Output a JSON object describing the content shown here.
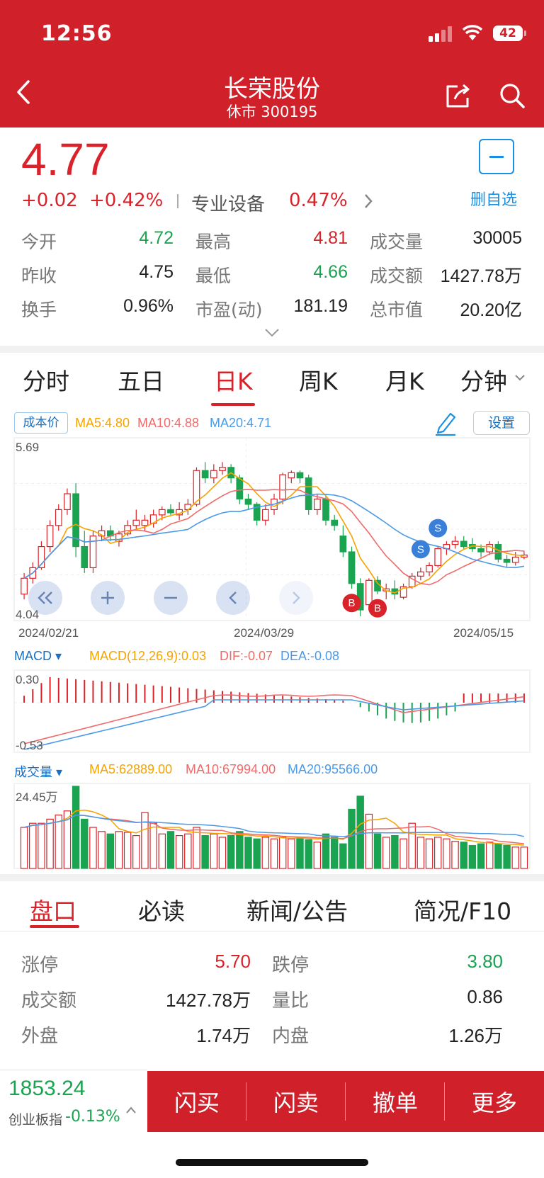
{
  "status": {
    "time": "12:56",
    "battery": "42"
  },
  "header": {
    "title": "长荣股份",
    "subtitle": "休市 300195"
  },
  "quote": {
    "price": "4.77",
    "change": "+0.02",
    "change_pct": "+0.42%",
    "sector": "专业设备",
    "sector_pct": "0.47%",
    "fav_label": "删自选",
    "grid": [
      [
        {
          "label": "今开",
          "value": "4.72",
          "color": "#1aa350"
        },
        {
          "label": "最高",
          "value": "4.81",
          "color": "#d8232a"
        },
        {
          "label": "成交量",
          "value": "30005",
          "color": "#222"
        }
      ],
      [
        {
          "label": "昨收",
          "value": "4.75",
          "color": "#222"
        },
        {
          "label": "最低",
          "value": "4.66",
          "color": "#1aa350"
        },
        {
          "label": "成交额",
          "value": "1427.78万",
          "color": "#222"
        }
      ],
      [
        {
          "label": "换手",
          "value": "0.96%",
          "color": "#222"
        },
        {
          "label": "市盈(动)",
          "value": "181.19",
          "color": "#222"
        },
        {
          "label": "总市值",
          "value": "20.20亿",
          "color": "#222"
        }
      ]
    ]
  },
  "tabs": [
    "分时",
    "五日",
    "日K",
    "周K",
    "月K",
    "分钟"
  ],
  "active_tab": "日K",
  "chart_toolbar": {
    "cost_label": "成本价",
    "ma5": "MA5:4.80",
    "ma10": "MA10:4.88",
    "ma20": "MA20:4.71",
    "settings": "设置"
  },
  "colors": {
    "up": "#d8232a",
    "down": "#1aa350",
    "ma5": "#f5a300",
    "ma10": "#f06a6a",
    "ma20": "#4a9ae8",
    "brand": "#d0202a",
    "link": "#1a8fe3"
  },
  "kline": {
    "ymax": "5.69",
    "ymin": "4.04",
    "dates": [
      "2024/02/21",
      "2024/03/29",
      "2024/05/15"
    ],
    "markers": [
      "S",
      "S",
      "B",
      "B"
    ]
  },
  "macd": {
    "label": "MACD",
    "params": "MACD(12,26,9):0.03",
    "dif": "DIF:-0.07",
    "dea": "DEA:-0.08",
    "ymax": "0.30",
    "ymin": "-0.53"
  },
  "volume": {
    "label": "成交量",
    "ma5": "MA5:62889.00",
    "ma10": "MA10:67994.00",
    "ma20": "MA20:95566.00",
    "ymax": "24.45万"
  },
  "chart_data": {
    "type": "candlestick",
    "x_range": [
      "2024/02/21",
      "2024/05/15"
    ],
    "ylim": [
      4.04,
      5.69
    ],
    "series_candles": [
      {
        "o": 4.25,
        "h": 4.45,
        "l": 4.2,
        "c": 4.4
      },
      {
        "o": 4.4,
        "h": 4.55,
        "l": 4.35,
        "c": 4.5
      },
      {
        "o": 4.5,
        "h": 4.75,
        "l": 4.48,
        "c": 4.7
      },
      {
        "o": 4.7,
        "h": 4.95,
        "l": 4.65,
        "c": 4.9
      },
      {
        "o": 4.9,
        "h": 5.1,
        "l": 4.85,
        "c": 5.05
      },
      {
        "o": 5.05,
        "h": 5.25,
        "l": 5.0,
        "c": 5.2
      },
      {
        "o": 5.2,
        "h": 5.3,
        "l": 4.6,
        "c": 4.7
      },
      {
        "o": 4.7,
        "h": 4.85,
        "l": 4.45,
        "c": 4.5
      },
      {
        "o": 4.5,
        "h": 4.85,
        "l": 4.45,
        "c": 4.8
      },
      {
        "o": 4.8,
        "h": 4.9,
        "l": 4.75,
        "c": 4.85
      },
      {
        "o": 4.85,
        "h": 4.9,
        "l": 4.75,
        "c": 4.8
      },
      {
        "o": 4.75,
        "h": 4.85,
        "l": 4.7,
        "c": 4.82
      },
      {
        "o": 4.82,
        "h": 4.95,
        "l": 4.8,
        "c": 4.9
      },
      {
        "o": 4.9,
        "h": 5.05,
        "l": 4.85,
        "c": 4.95
      },
      {
        "o": 4.9,
        "h": 5.0,
        "l": 4.85,
        "c": 4.95
      },
      {
        "o": 4.92,
        "h": 5.05,
        "l": 4.88,
        "c": 5.0
      },
      {
        "o": 5.0,
        "h": 5.08,
        "l": 4.95,
        "c": 5.05
      },
      {
        "o": 5.05,
        "h": 5.1,
        "l": 5.0,
        "c": 5.02
      },
      {
        "o": 5.0,
        "h": 5.12,
        "l": 4.95,
        "c": 5.05
      },
      {
        "o": 5.05,
        "h": 5.15,
        "l": 5.0,
        "c": 5.1
      },
      {
        "o": 5.1,
        "h": 5.45,
        "l": 5.08,
        "c": 5.42
      },
      {
        "o": 5.42,
        "h": 5.5,
        "l": 5.3,
        "c": 5.35
      },
      {
        "o": 5.35,
        "h": 5.48,
        "l": 5.3,
        "c": 5.42
      },
      {
        "o": 5.42,
        "h": 5.5,
        "l": 5.38,
        "c": 5.45
      },
      {
        "o": 5.45,
        "h": 5.48,
        "l": 5.3,
        "c": 5.35
      },
      {
        "o": 5.35,
        "h": 5.38,
        "l": 5.1,
        "c": 5.15
      },
      {
        "o": 5.15,
        "h": 5.2,
        "l": 5.05,
        "c": 5.1
      },
      {
        "o": 5.1,
        "h": 5.12,
        "l": 4.9,
        "c": 4.95
      },
      {
        "o": 4.95,
        "h": 5.1,
        "l": 4.9,
        "c": 5.05
      },
      {
        "o": 5.05,
        "h": 5.2,
        "l": 5.0,
        "c": 5.15
      },
      {
        "o": 5.15,
        "h": 5.4,
        "l": 5.1,
        "c": 5.38
      },
      {
        "o": 5.35,
        "h": 5.42,
        "l": 5.3,
        "c": 5.4
      },
      {
        "o": 5.4,
        "h": 5.42,
        "l": 5.3,
        "c": 5.35
      },
      {
        "o": 5.35,
        "h": 5.38,
        "l": 5.0,
        "c": 5.05
      },
      {
        "o": 5.05,
        "h": 5.2,
        "l": 5.0,
        "c": 5.15
      },
      {
        "o": 5.15,
        "h": 5.2,
        "l": 4.9,
        "c": 4.95
      },
      {
        "o": 4.95,
        "h": 5.0,
        "l": 4.85,
        "c": 4.9
      },
      {
        "o": 4.8,
        "h": 4.9,
        "l": 4.6,
        "c": 4.65
      },
      {
        "o": 4.65,
        "h": 4.7,
        "l": 4.3,
        "c": 4.35
      },
      {
        "o": 4.35,
        "h": 4.4,
        "l": 4.04,
        "c": 4.1
      },
      {
        "o": 4.15,
        "h": 4.4,
        "l": 4.1,
        "c": 4.38
      },
      {
        "o": 4.38,
        "h": 4.42,
        "l": 4.25,
        "c": 4.28
      },
      {
        "o": 4.28,
        "h": 4.35,
        "l": 4.2,
        "c": 4.3
      },
      {
        "o": 4.3,
        "h": 4.38,
        "l": 4.2,
        "c": 4.25
      },
      {
        "o": 4.22,
        "h": 4.35,
        "l": 4.2,
        "c": 4.32
      },
      {
        "o": 4.32,
        "h": 4.45,
        "l": 4.3,
        "c": 4.42
      },
      {
        "o": 4.42,
        "h": 4.5,
        "l": 4.38,
        "c": 4.46
      },
      {
        "o": 4.46,
        "h": 4.55,
        "l": 4.42,
        "c": 4.52
      },
      {
        "o": 4.52,
        "h": 4.7,
        "l": 4.5,
        "c": 4.68
      },
      {
        "o": 4.68,
        "h": 4.75,
        "l": 4.62,
        "c": 4.72
      },
      {
        "o": 4.72,
        "h": 4.8,
        "l": 4.68,
        "c": 4.75
      },
      {
        "o": 4.75,
        "h": 4.8,
        "l": 4.68,
        "c": 4.7
      },
      {
        "o": 4.72,
        "h": 4.78,
        "l": 4.65,
        "c": 4.68
      },
      {
        "o": 4.68,
        "h": 4.72,
        "l": 4.6,
        "c": 4.65
      },
      {
        "o": 4.65,
        "h": 4.75,
        "l": 4.62,
        "c": 4.72
      },
      {
        "o": 4.72,
        "h": 4.75,
        "l": 4.55,
        "c": 4.58
      },
      {
        "o": 4.58,
        "h": 4.62,
        "l": 4.5,
        "c": 4.55
      },
      {
        "o": 4.55,
        "h": 4.65,
        "l": 4.52,
        "c": 4.6
      },
      {
        "o": 4.6,
        "h": 4.66,
        "l": 4.58,
        "c": 4.62
      }
    ]
  }
}
